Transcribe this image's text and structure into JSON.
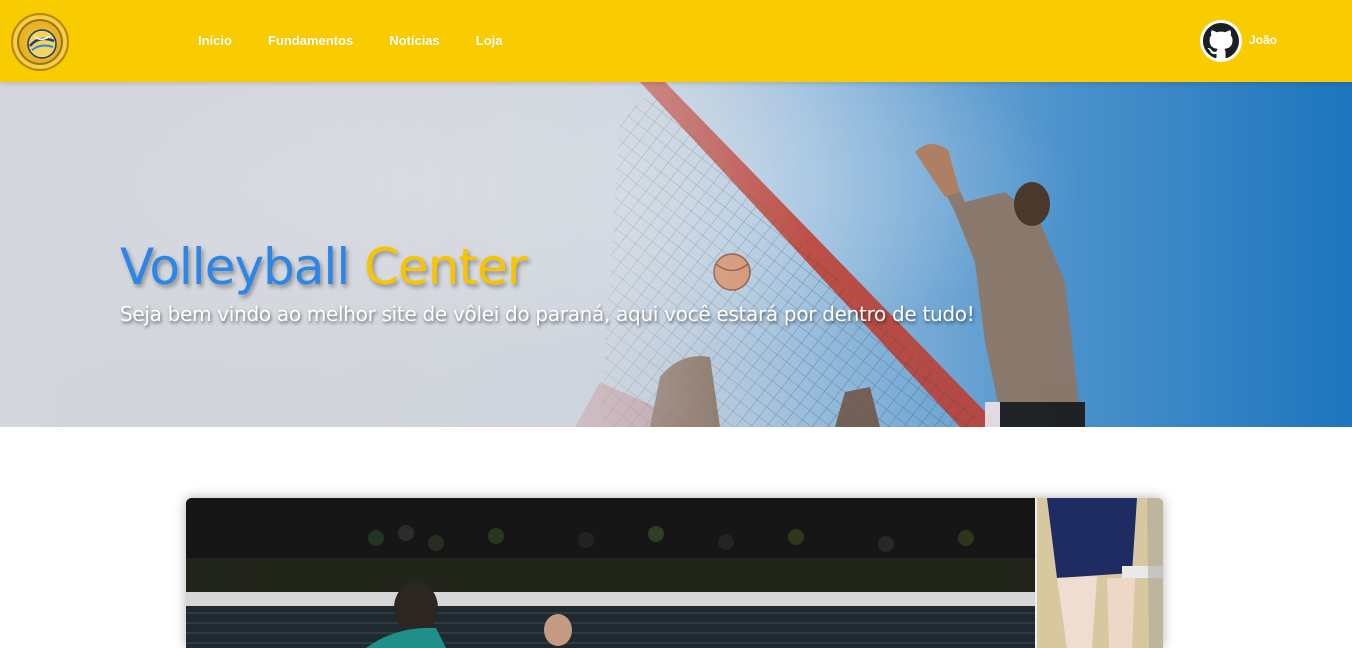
{
  "navbar": {
    "logo": {
      "icon": "volleyball-logo-badge",
      "colors": {
        "background": "#f8cc00"
      }
    },
    "links": [
      {
        "label": "Início"
      },
      {
        "label": "Fundamentos"
      },
      {
        "label": "Notícias"
      },
      {
        "label": "Loja"
      }
    ],
    "profile": {
      "icon": "github-icon",
      "username": "João"
    }
  },
  "hero": {
    "title_part1": "Volleyball",
    "title_part2": "Center",
    "subtitle": "Seja bem vindo ao melhor site de vôlei do paraná, aqui você estará por dentro de tudo!",
    "colors": {
      "title_blue": "#2b86e8",
      "title_gold": "#f8c400"
    }
  },
  "carousel": {
    "slides": [
      {
        "icon": "volleyball-match-photo"
      },
      {
        "icon": "volleyball-player-photo"
      }
    ]
  }
}
